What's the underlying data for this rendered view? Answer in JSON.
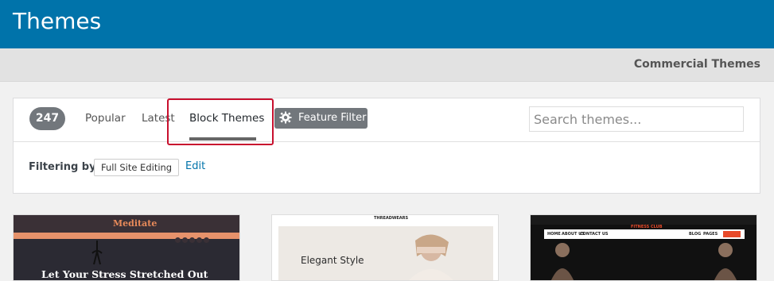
{
  "header": {
    "title": "Themes"
  },
  "subbar": {
    "commercial_label": "Commercial Themes"
  },
  "filterbar": {
    "count": "247",
    "tabs": [
      "Popular",
      "Latest",
      "Block Themes"
    ],
    "active_tab": "Block Themes",
    "feature_filter_label": "Feature Filter",
    "search_placeholder": "Search themes..."
  },
  "filtering": {
    "label": "Filtering by:",
    "tag": "Full Site Editing",
    "edit_label": "Edit"
  },
  "cards": [
    {
      "brand": "Meditate",
      "hero_text": "Let Your Stress Stretched Out"
    },
    {
      "brand": "THREADWEARS",
      "heading": "Elegant Style"
    },
    {
      "logo": "FITNESS CLUB",
      "nav": [
        "HOME",
        "ABOUT US",
        "CONTACT US"
      ],
      "nav_right": [
        "BLOG",
        "PAGES"
      ]
    }
  ],
  "colors": {
    "header": "#0073aa",
    "highlight": "#c8102e",
    "accent": "#e84a2a"
  }
}
